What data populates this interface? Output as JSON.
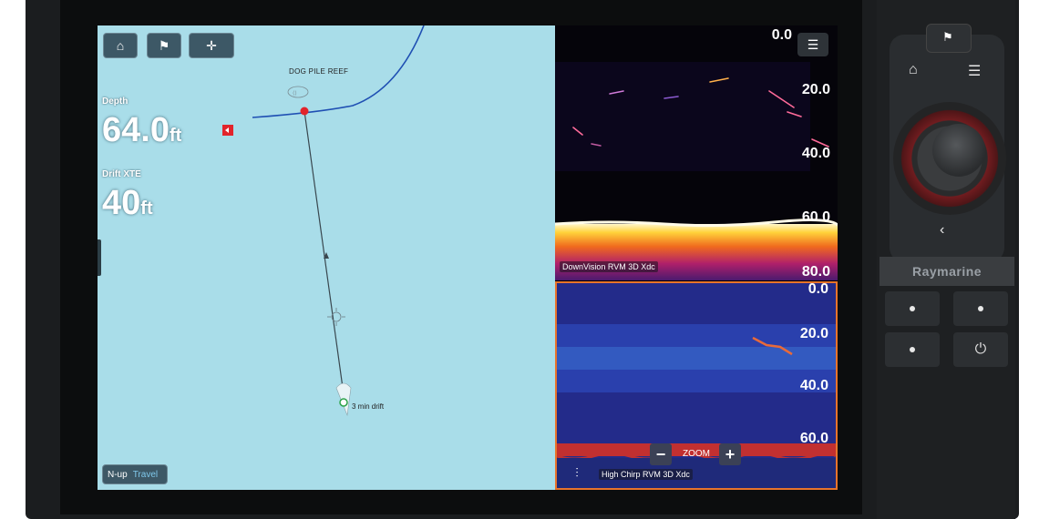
{
  "toolbar": {
    "home_icon": "home-icon",
    "waypoint_icon": "waypoint-flag-icon",
    "cursor_icon": "crosshair-icon"
  },
  "chart": {
    "depth_label": "Depth",
    "depth_value": "64.0",
    "depth_unit": "ft",
    "drift_label": "Drift XTE",
    "drift_value": "40",
    "drift_unit": "ft",
    "reef_name": "DOG PILE REEF",
    "drift_text": "3 min drift",
    "mode_primary": "N-up",
    "mode_secondary": "Travel",
    "background": "#a9dde9",
    "track_color": "#1f4fb3",
    "marker_color": "#e2242b"
  },
  "downvision": {
    "title": "DownVision RVM 3D Xdc",
    "scale": [
      "0.0",
      "20.0",
      "40.0",
      "60.0",
      "80.0"
    ]
  },
  "highchirp": {
    "title": "High Chirp RVM 3D Xdc",
    "scale": [
      "0.0",
      "20.0",
      "40.0",
      "60.0"
    ],
    "zoom_label": "ZOOM",
    "zoom_minus": "−",
    "zoom_plus": "+",
    "border_color": "#e8742b"
  },
  "panel": {
    "brand": "Raymarine",
    "home_icon": "home-icon",
    "menu_icon": "menu-icon",
    "back_icon": "chevron-left-icon",
    "power_icon": "power-icon"
  }
}
